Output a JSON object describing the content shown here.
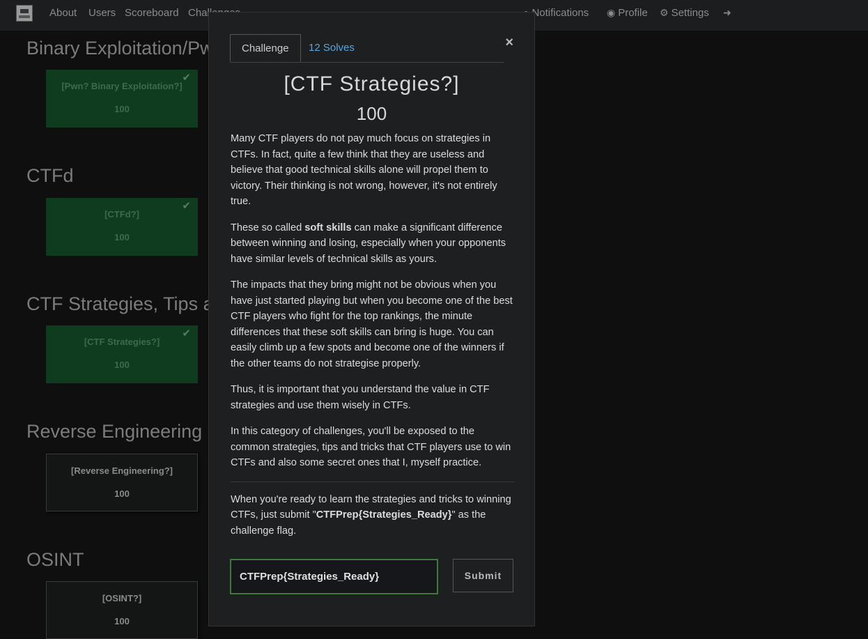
{
  "navbar": {
    "links": [
      "About",
      "Users",
      "Scoreboard",
      "Challenges"
    ],
    "right": [
      {
        "icon": "bell-icon",
        "label": "Notifications"
      },
      {
        "icon": "user-circle-icon",
        "label": "Profile"
      },
      {
        "icon": "gears-icon",
        "label": "Settings"
      }
    ]
  },
  "categories": [
    {
      "title": "Binary Exploitation/Pwn",
      "card": {
        "name": "[Pwn? Binary Exploitation?]",
        "value": "100",
        "solved": true
      }
    },
    {
      "title": "CTFd",
      "card": {
        "name": "[CTFd?]",
        "value": "100",
        "solved": true
      }
    },
    {
      "title": "CTF Strategies, Tips and Tricks",
      "card": {
        "name": "[CTF Strategies?]",
        "value": "100",
        "solved": true
      }
    },
    {
      "title": "Reverse Engineering",
      "card": {
        "name": "[Reverse Engineering?]",
        "value": "100",
        "solved": false
      }
    },
    {
      "title": "OSINT",
      "card": {
        "name": "[OSINT?]",
        "value": "100",
        "solved": false
      }
    }
  ],
  "modal": {
    "tabs": {
      "challenge": "Challenge",
      "solves": "12 Solves"
    },
    "close": "×",
    "title": "[CTF Strategies?]",
    "value": "100",
    "paragraphs": {
      "p1": "Many CTF players do not pay much focus on strategies in CTFs. In fact, quite a few think that they are useless and believe that good technical skills alone will propel them to victory. Their thinking is not wrong, however, it's not entirely true.",
      "p2_a": "These so called ",
      "p2_bold": "soft skills",
      "p2_b": " can make a significant difference between winning and losing, especially when your opponents have similar levels of technical skills as yours.",
      "p3": "The impacts that they bring might not be obvious when you have just started playing but when you become one of the best CTF players who fight for the top rankings, the minute differences that these soft skills can bring is huge. You can easily climb up a few spots and become one of the winners if the other teams do not strategise properly.",
      "p4": "Thus, it is important that you understand the value in CTF strategies and use them wisely in CTFs.",
      "p5": "In this category of challenges, you'll be exposed to the common strategies, tips and tricks that CTF players use to win CTFs and also some secret ones that I, myself practice.",
      "p6_a": "When you're ready to learn the strategies and tricks to winning CTFs, just submit \"",
      "p6_bold": "CTFPrep{Strategies_Ready}",
      "p6_b": "\" as the challenge flag."
    },
    "flag_value": "CTFPrep{Strategies_Ready}",
    "submit_label": "Submit"
  }
}
